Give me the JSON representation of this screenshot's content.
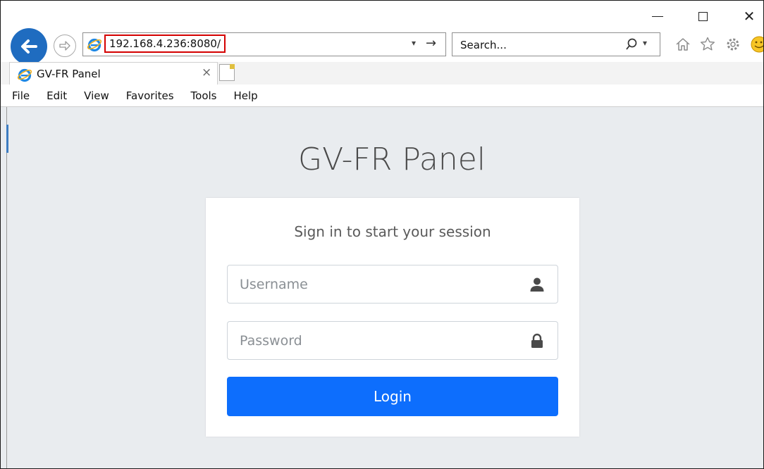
{
  "browser": {
    "address_url": "192.168.4.236:8080/",
    "search_placeholder": "Search...",
    "tab_title": "GV-FR Panel",
    "close_glyph": "×",
    "close_window_glyph": "✕",
    "drop_arrow": "▾",
    "go_arrow": "→",
    "menu": [
      "File",
      "Edit",
      "View",
      "Favorites",
      "Tools",
      "Help"
    ],
    "icons": [
      "back-arrow-icon",
      "forward-arrow-icon",
      "ie-logo-icon",
      "search-icon",
      "home-icon",
      "star-icon",
      "gear-icon",
      "smiley-icon",
      "new-tab-icon",
      "minimize-icon",
      "maximize-icon",
      "close-icon"
    ]
  },
  "login": {
    "heading": "GV-FR Panel",
    "subtitle": "Sign in to start your session",
    "username_placeholder": "Username",
    "password_placeholder": "Password",
    "login_label": "Login",
    "accent_color": "#0d6efd"
  }
}
